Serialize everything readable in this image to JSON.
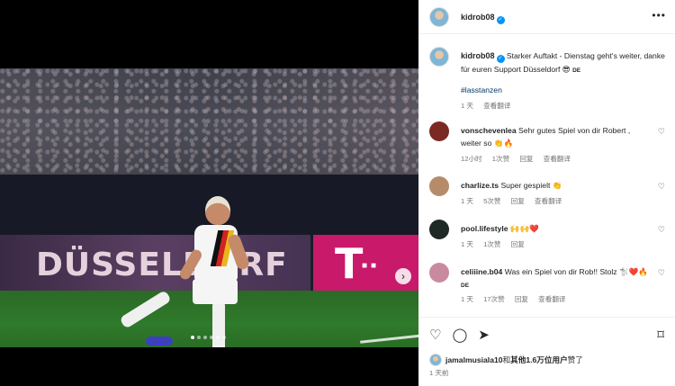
{
  "post": {
    "username": "kidrob08",
    "caption": "Starker Auftakt - Dienstag geht's weiter, danke für euren Support Düsseldorf 😎",
    "caption_lang": "DE",
    "hashtag": "#lasstanzen",
    "caption_time": "1 天",
    "see_translation": "查看翻译"
  },
  "media": {
    "board_text": "DÜSSELDORF",
    "sponsor_letter": "T",
    "carousel_index": 1,
    "carousel_count": 6
  },
  "comments": [
    {
      "username": "vonschevenlea",
      "text": "Sehr gutes Spiel von dir Robert , weiter so 👏🔥",
      "time": "12小时",
      "likes": "1次赞",
      "reply": "回复",
      "translate": "查看翻译",
      "avatar_color": "#7a2a22"
    },
    {
      "username": "charlize.ts",
      "text": "Super gespielt 👏",
      "time": "1 天",
      "likes": "5次赞",
      "reply": "回复",
      "translate": "查看翻译",
      "avatar_color": "#b58b6a"
    },
    {
      "username": "pool.lifestyle",
      "text": "🙌🙌❤️",
      "time": "1 天",
      "likes": "1次赞",
      "reply": "回复",
      "translate": "",
      "avatar_color": "#1f2a26"
    },
    {
      "username": "celiiine.b04",
      "text": "Was ein Spiel von dir Rob!! Stolz 🐩❤️🔥",
      "lang": "DE",
      "time": "1 天",
      "likes": "17次赞",
      "reply": "回复",
      "translate": "查看翻译",
      "avatar_color": "#c98aa0"
    }
  ],
  "footer": {
    "liked_by_user": "jamalmusiala10",
    "liked_by_mid": "和",
    "liked_by_others": "其他1.6万位用户",
    "liked_by_suffix": "赞了",
    "posted_time": "1 天前"
  },
  "icons": {
    "heart": "♡",
    "comment": "◯",
    "share": "➤",
    "bookmark": "⌑",
    "more": "•••",
    "next": "›"
  },
  "colors": {
    "verified": "#0095f6",
    "link": "#00376b",
    "muted": "#737373",
    "telekom": "#c8196b"
  }
}
